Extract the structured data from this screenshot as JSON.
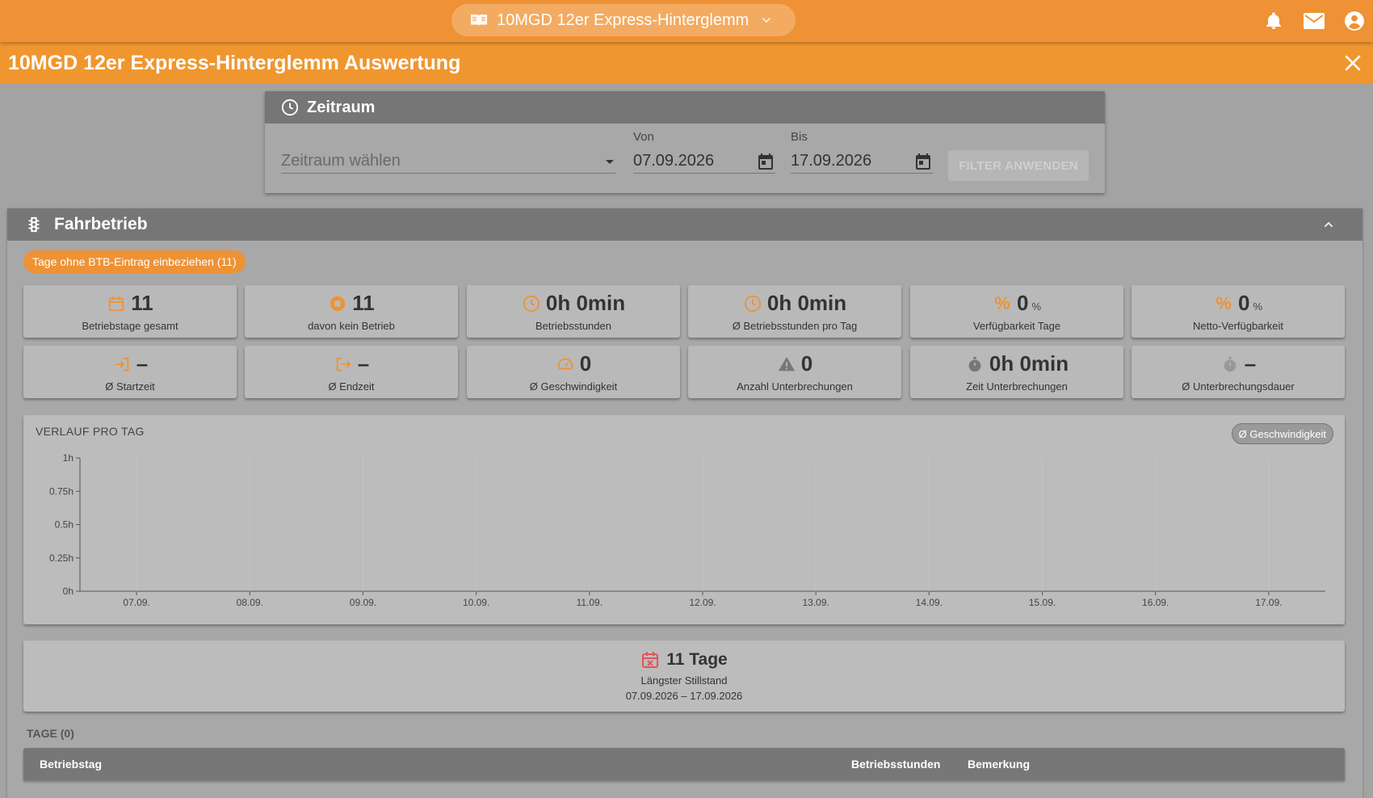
{
  "topbar": {
    "project_name": "10MGD 12er Express-Hinterglemm",
    "icons": [
      "book-icon",
      "chevron-down-icon",
      "bell-icon",
      "mail-icon",
      "account-icon"
    ]
  },
  "titlebar": {
    "title": "10MGD 12er Express-Hinterglemm Auswertung"
  },
  "zeitraum": {
    "title": "Zeitraum",
    "select_placeholder": "Zeitraum wählen",
    "von_label": "Von",
    "von_value": "07.09.2026",
    "bis_label": "Bis",
    "bis_value": "17.09.2026",
    "filter_button": "FILTER ANWENDEN"
  },
  "fahrbetrieb": {
    "title": "Fahrbetrieb",
    "chip": "Tage ohne BTB-Eintrag einbeziehen (11)",
    "stats": [
      {
        "value": "11",
        "unit": "",
        "label": "Betriebstage gesamt",
        "icon": "calendar-icon"
      },
      {
        "value": "11",
        "unit": "",
        "label": "davon kein Betrieb",
        "icon": "stop-circle-icon"
      },
      {
        "value": "0h 0min",
        "unit": "",
        "label": "Betriebsstunden",
        "icon": "clock-icon"
      },
      {
        "value": "0h 0min",
        "unit": "",
        "label": "Ø Betriebsstunden pro Tag",
        "icon": "clock-icon"
      },
      {
        "value": "0",
        "unit": "%",
        "label": "Verfügbarkeit Tage",
        "icon": "percent-icon"
      },
      {
        "value": "0",
        "unit": "%",
        "label": "Netto-Verfügbarkeit",
        "icon": "percent-icon"
      },
      {
        "value": "–",
        "unit": "",
        "label": "Ø Startzeit",
        "icon": "login-icon"
      },
      {
        "value": "–",
        "unit": "",
        "label": "Ø Endzeit",
        "icon": "logout-icon"
      },
      {
        "value": "0",
        "unit": "",
        "label": "Ø Geschwindigkeit",
        "icon": "speedometer-icon"
      },
      {
        "value": "0",
        "unit": "",
        "label": "Anzahl Unterbrechungen",
        "icon": "warning-icon"
      },
      {
        "value": "0h 0min",
        "unit": "",
        "label": "Zeit Unterbrechungen",
        "icon": "stopwatch-icon"
      },
      {
        "value": "–",
        "unit": "",
        "label": "Ø Unterbrechungsdauer",
        "icon": "stopwatch-icon"
      }
    ],
    "chart_title": "VERLAUF PRO TAG",
    "chart_toggle": "Ø Geschwindigkeit",
    "stillstand": {
      "value": "11 Tage",
      "label": "Längster Stillstand",
      "range": "07.09.2026 – 17.09.2026"
    },
    "tage_label": "TAGE (0)",
    "table_columns": [
      "Betriebstag",
      "Betriebsstunden",
      "Bemerkung"
    ]
  },
  "colors": {
    "accent": "#ee9235",
    "header_gray": "#767676",
    "danger": "#e05555"
  },
  "chart_data": {
    "type": "bar",
    "title": "VERLAUF PRO TAG",
    "xlabel": "",
    "ylabel": "",
    "categories": [
      "07.09.",
      "08.09.",
      "09.09.",
      "10.09.",
      "11.09.",
      "12.09.",
      "13.09.",
      "14.09.",
      "15.09.",
      "16.09.",
      "17.09."
    ],
    "values": [
      0,
      0,
      0,
      0,
      0,
      0,
      0,
      0,
      0,
      0,
      0
    ],
    "yticks": [
      "0h",
      "0.25h",
      "0.5h",
      "0.75h",
      "1h"
    ],
    "ylim": [
      0,
      1
    ],
    "grid": false
  }
}
